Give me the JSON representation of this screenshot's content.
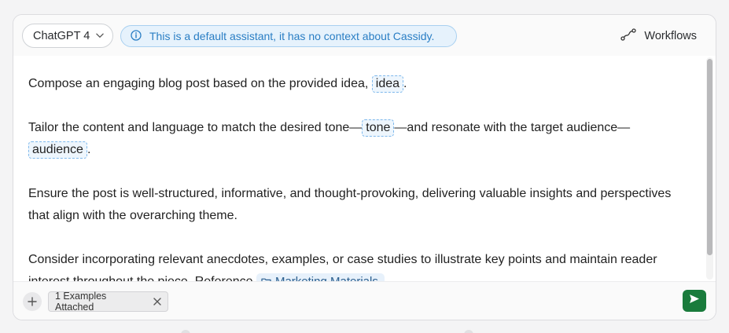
{
  "header": {
    "model_label": "ChatGPT 4",
    "info_text": "This is a default assistant, it has no context about Cassidy.",
    "workflows_label": "Workflows"
  },
  "editor": {
    "p1": {
      "text": "Compose an engaging blog post based on the provided idea, ",
      "var": "idea",
      "end": "."
    },
    "p2": {
      "text1": "Tailor the content and language to match the desired tone—",
      "var1": "tone",
      "text2": "—and resonate with the target audience—",
      "var2": "audience",
      "end": "."
    },
    "p3": {
      "text": "Ensure the post is well-structured, informative, and thought-provoking, delivering valuable insights and perspectives that align with the overarching theme."
    },
    "p4": {
      "text": "Consider incorporating relevant anecdotes, examples, or case studies to illustrate key points and maintain reader interest throughout the piece. Reference ",
      "ref": "Marketing Materials"
    }
  },
  "footer": {
    "examples_label": "1 Examples Attached"
  },
  "colors": {
    "accent_green": "#1a7b3c",
    "info_blue": "#2a7ec4",
    "variable_border": "#7db8ec"
  }
}
